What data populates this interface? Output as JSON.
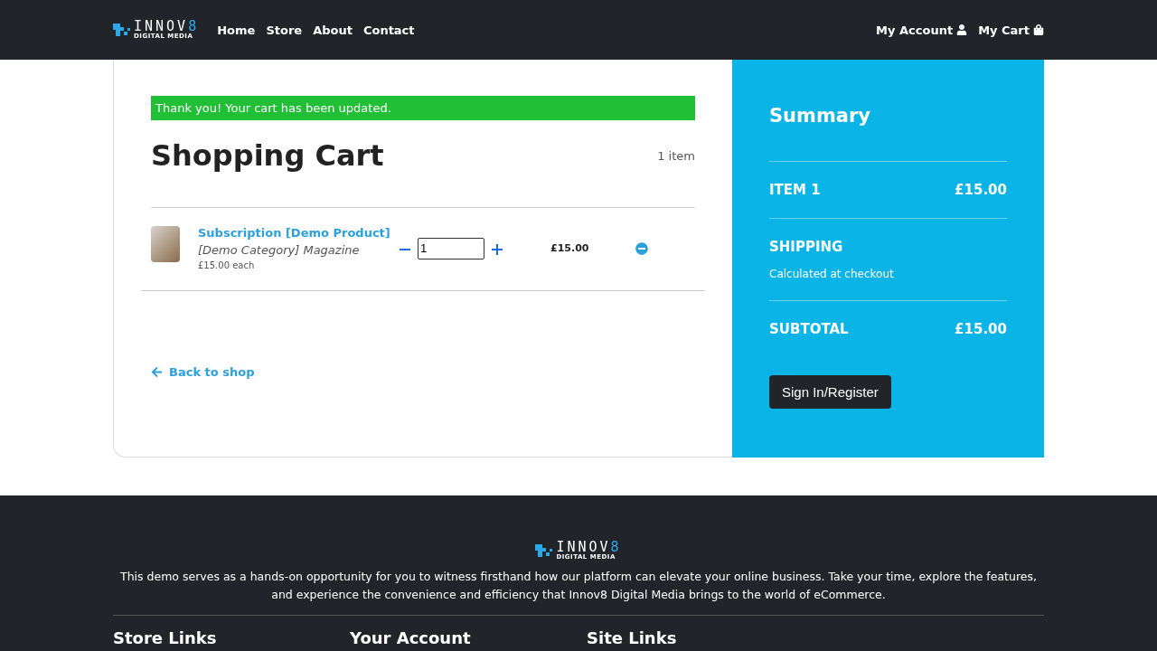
{
  "logo": {
    "top": "INNOV",
    "accent": "8",
    "bottom": "DIGITAL MEDIA"
  },
  "nav": {
    "links": [
      "Home",
      "Store",
      "About",
      "Contact"
    ],
    "account": "My Account",
    "cart": "My Cart"
  },
  "alert": "Thank you! Your cart has been updated.",
  "cart": {
    "title": "Shopping Cart",
    "count": "1 item",
    "items": [
      {
        "name": "Subscription [Demo Product]",
        "category": "[Demo Category] Magazine",
        "each": "£15.00 each",
        "quantity": "1",
        "total": "£15.00"
      }
    ],
    "back": "Back to shop"
  },
  "summary": {
    "title": "Summary",
    "rows": [
      {
        "label": "ITEM 1",
        "value": "£15.00"
      },
      {
        "label": "SHIPPING",
        "note": "Calculated at checkout"
      },
      {
        "label": "SUBTOTAL",
        "value": "£15.00"
      }
    ],
    "button": "Sign In/Register"
  },
  "footer": {
    "logo": {
      "top": "INNOV",
      "accent": "8",
      "bottom": "DIGITAL MEDIA"
    },
    "text": "This demo serves as a hands-on opportunity for you to witness firsthand how our platform can elevate your online business. Take your time, explore the features, and experience the convenience and efficiency that Innov8 Digital Media brings to the world of eCommerce.",
    "headings": [
      "Store Links",
      "Your Account",
      "Site Links"
    ]
  }
}
